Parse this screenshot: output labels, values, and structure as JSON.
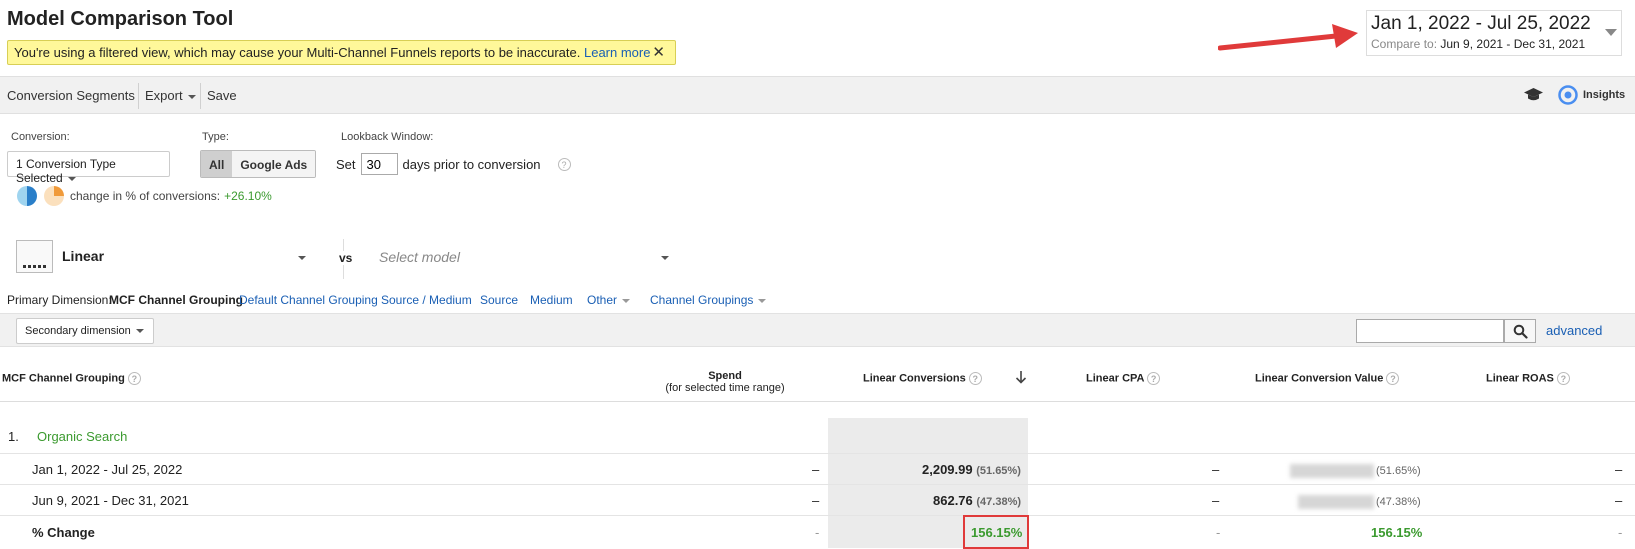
{
  "header": {
    "title": "Model Comparison Tool",
    "notice_text": "You're using a filtered view, which may cause your Multi-Channel Funnels reports to be inaccurate.",
    "notice_link": "Learn more",
    "close_glyph": "✕"
  },
  "date_range": {
    "main": "Jan 1, 2022 - Jul 25, 2022",
    "compare_label": "Compare to:",
    "compare_range": "Jun 9, 2021 - Dec 31, 2021"
  },
  "toolbar": {
    "conversion_segments": "Conversion Segments",
    "export": "Export",
    "save": "Save",
    "insights": "Insights"
  },
  "filters": {
    "conversion_label": "Conversion:",
    "conversion_value": "1 Conversion Type Selected",
    "type_label": "Type:",
    "type_all": "All",
    "type_google_ads": "Google Ads",
    "lookback_label": "Lookback Window:",
    "lookback_prefix": "Set",
    "lookback_value": "30",
    "lookback_suffix": "days prior to conversion",
    "change_label": "change in % of conversions:",
    "change_value": "+26.10%"
  },
  "models": {
    "model1": "Linear",
    "vs": "vs",
    "model2_placeholder": "Select model"
  },
  "dimensions": {
    "label": "Primary Dimension:",
    "active": "MCF Channel Grouping",
    "items": [
      "Default Channel Grouping",
      "Source / Medium",
      "Source",
      "Medium",
      "Other",
      "Channel Groupings"
    ]
  },
  "secondary": {
    "label": "Secondary dimension",
    "advanced": "advanced"
  },
  "table": {
    "columns": {
      "channel": "MCF Channel Grouping",
      "spend_line1": "Spend",
      "spend_line2": "(for selected time range)",
      "conversions": "Linear Conversions",
      "cpa": "Linear CPA",
      "value": "Linear Conversion Value",
      "roas": "Linear ROAS"
    },
    "group": {
      "index": "1.",
      "name": "Organic Search"
    },
    "rows": [
      {
        "label": "Jan 1, 2022 - Jul 25, 2022",
        "spend": "–",
        "conversions": "2,209.99",
        "conversions_pct": "(51.65%)",
        "cpa": "–",
        "value_pct": "(51.65%)",
        "roas": "–"
      },
      {
        "label": "Jun 9, 2021 - Dec 31, 2021",
        "spend": "–",
        "conversions": "862.76",
        "conversions_pct": "(47.38%)",
        "cpa": "–",
        "value_pct": "(47.38%)",
        "roas": "–"
      },
      {
        "label": "% Change",
        "spend": "-",
        "conversions": "156.15%",
        "cpa": "-",
        "value": "156.15%",
        "roas": "-"
      }
    ]
  },
  "colors": {
    "accent_link": "#1a5fb4",
    "positive": "#3b9a2f",
    "highlight": "#e03a3a",
    "notice_bg": "#fff89a"
  }
}
